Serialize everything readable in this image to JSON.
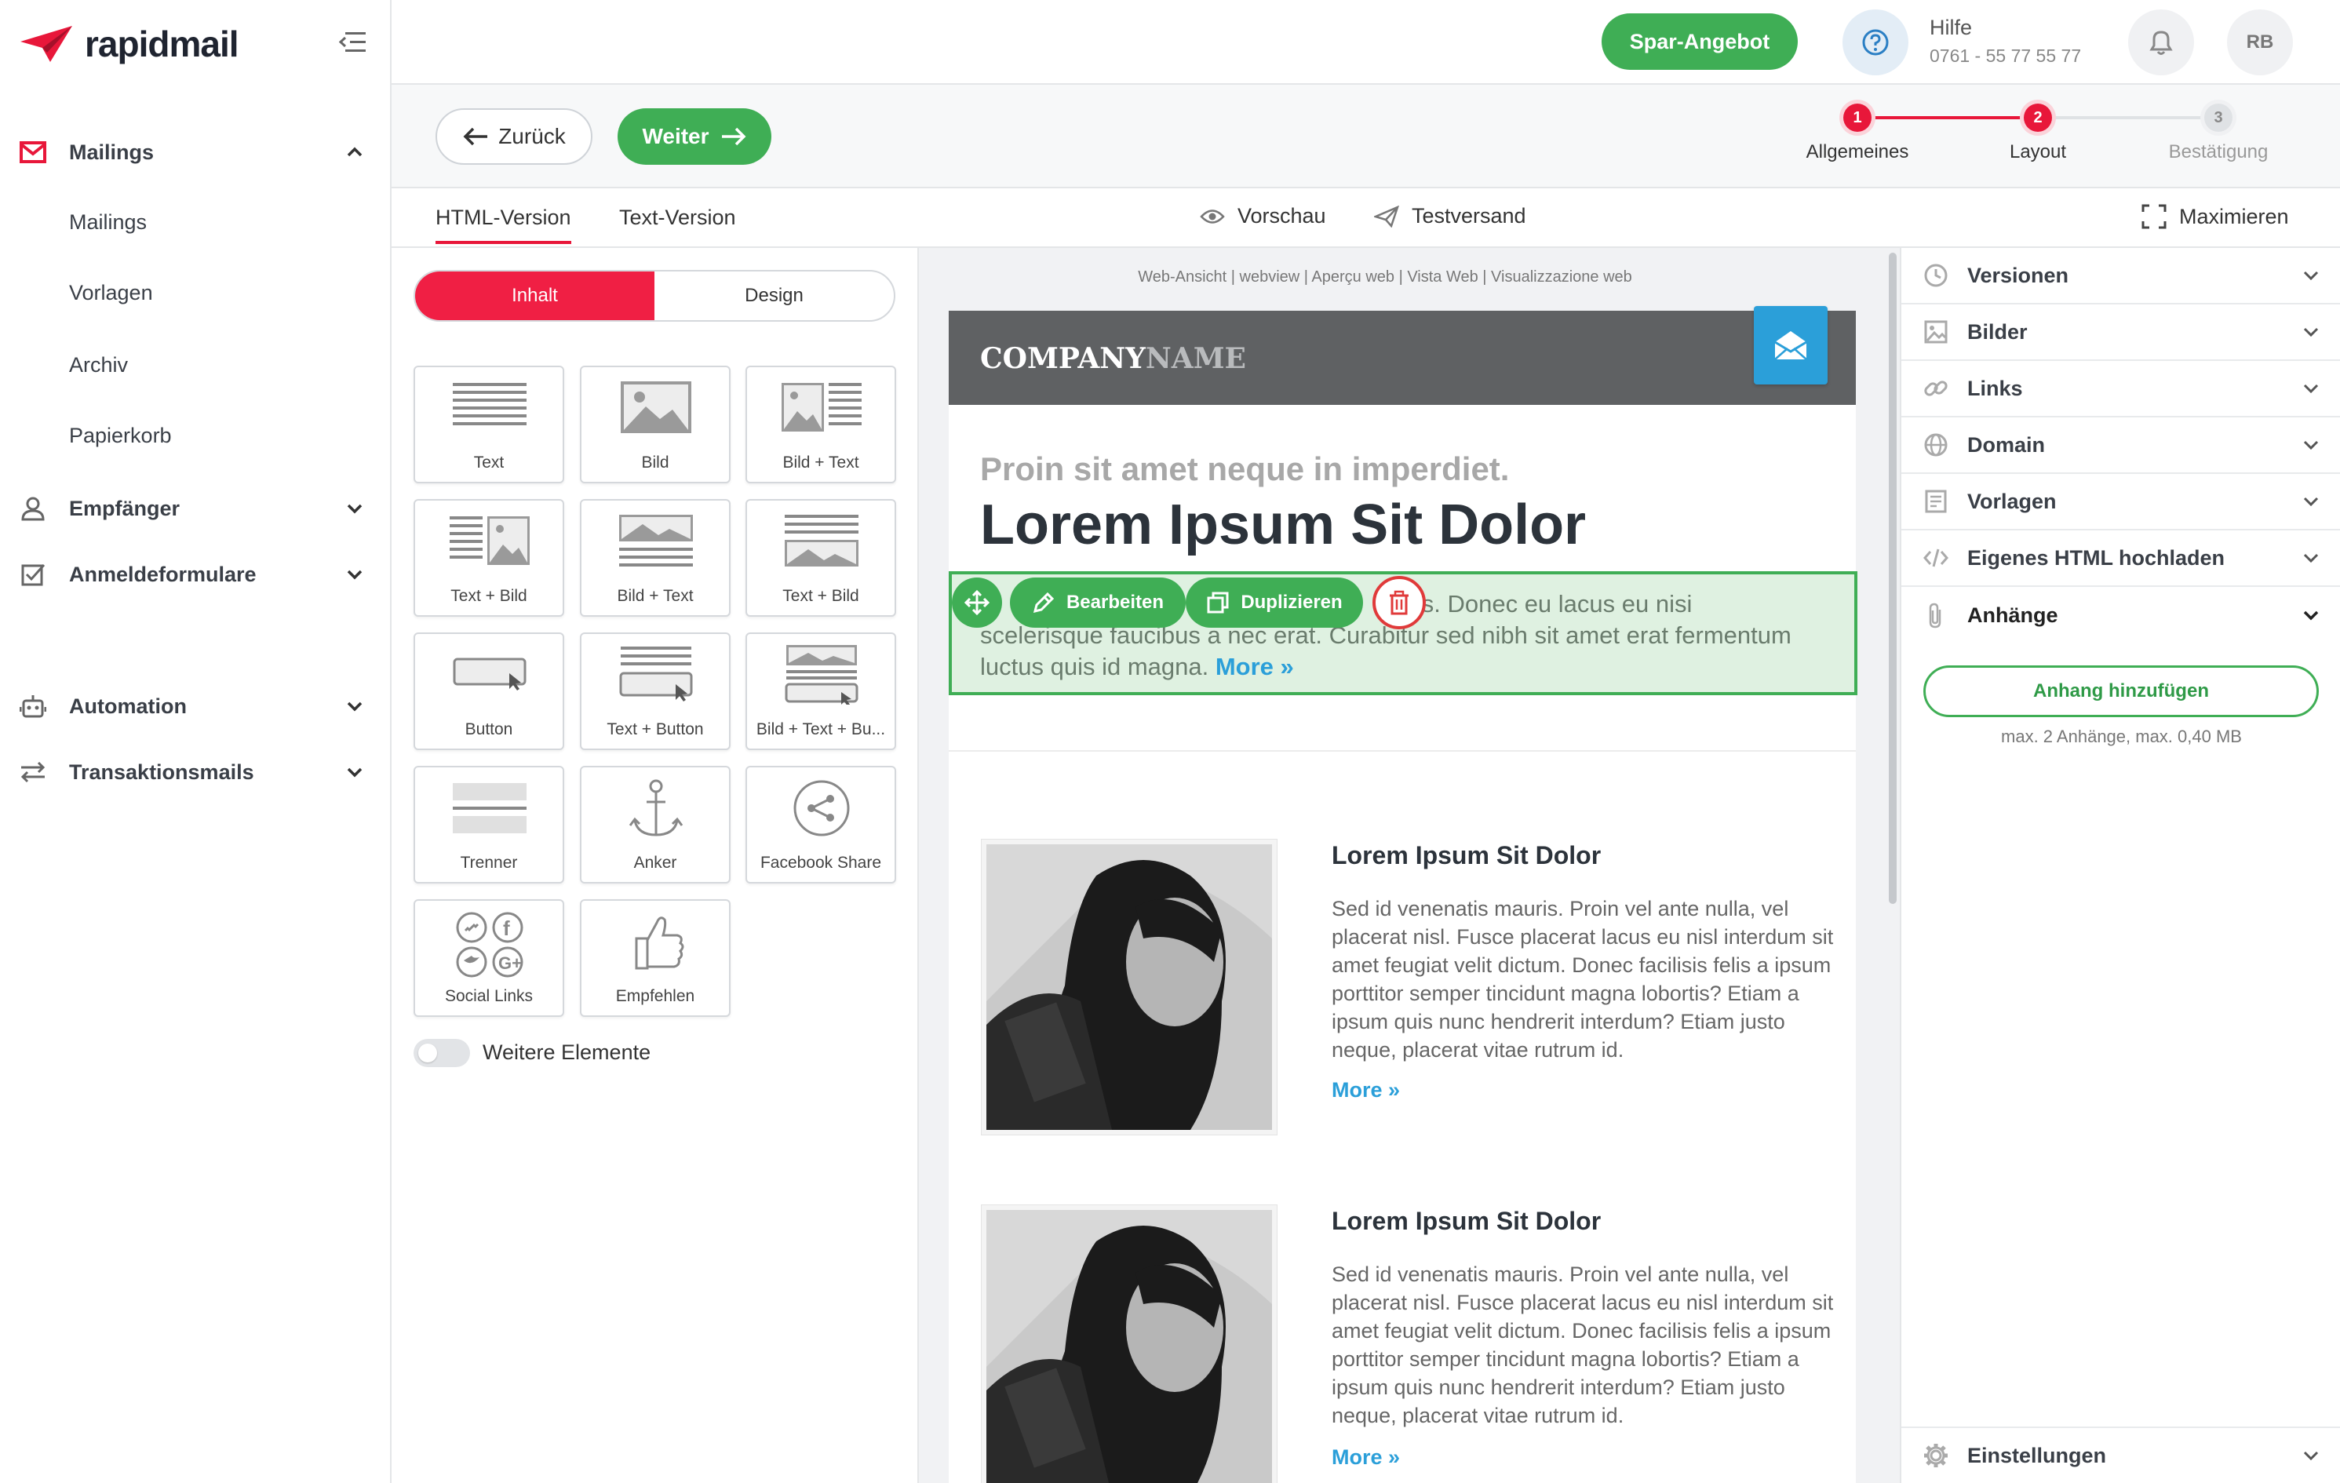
{
  "app": {
    "name": "rapidmail"
  },
  "colors": {
    "brand_red": "#e8173a",
    "green": "#3fae55",
    "blue": "#2b9fd9"
  },
  "sidebar": {
    "mailings": {
      "label": "Mailings",
      "icon": "mail-icon"
    },
    "sub_items": [
      "Mailings",
      "Vorlagen",
      "Archiv",
      "Papierkorb"
    ],
    "empfaenger": {
      "label": "Empfänger",
      "icon": "user-icon"
    },
    "anmeldeformulare": {
      "label": "Anmeldeformulare",
      "icon": "checkbox-icon"
    },
    "automation": {
      "label": "Automation",
      "icon": "robot-icon"
    },
    "transaktionsmails": {
      "label": "Transaktionsmails",
      "icon": "swap-icon"
    }
  },
  "header": {
    "spar_label": "Spar-Angebot",
    "help_title": "Hilfe",
    "help_phone": "0761 - 55 77 55 77",
    "avatar_initials": "RB"
  },
  "toolbar": {
    "back_label": "Zurück",
    "next_label": "Weiter",
    "steps": [
      {
        "num": "1",
        "label": "Allgemeines",
        "state": "done"
      },
      {
        "num": "2",
        "label": "Layout",
        "state": "active"
      },
      {
        "num": "3",
        "label": "Bestätigung",
        "state": "pending"
      }
    ]
  },
  "tabs": {
    "html_version": "HTML-Version",
    "text_version": "Text-Version",
    "preview": "Vorschau",
    "test_send": "Testversand",
    "maximize": "Maximieren"
  },
  "blocks": {
    "segment": {
      "content": "Inhalt",
      "design": "Design"
    },
    "tiles": [
      "Text",
      "Bild",
      "Bild + Text",
      "Text + Bild",
      "Bild + Text",
      "Text + Bild",
      "Button",
      "Text + Button",
      "Bild + Text + Bu...",
      "Trenner",
      "Anker",
      "Facebook Share",
      "Social Links",
      "Empfehlen"
    ],
    "more_elements": "Weitere Elemente"
  },
  "canvas": {
    "webview_links": "Web-Ansicht | webview | Aperçu web | Vista Web | Visualizzazione web",
    "company_a": "COMPANY",
    "company_b": "NAME",
    "subheading": "Proin sit amet neque in imperdiet.",
    "heading": "Lorem Ipsum Sit Dolor",
    "selected_text_a": "ces. Donec eu lacus eu nisi",
    "selected_text_b": "scelerisque faucibus a nec erat. Curabitur sed nibh sit amet erat fermentum luctus quis id magna. ",
    "selected_more": "More »",
    "edit_label": "Bearbeiten",
    "duplicate_label": "Duplizieren",
    "articles": [
      {
        "title": "Lorem Ipsum Sit Dolor",
        "body": "Sed id venenatis mauris. Proin vel ante nulla, vel placerat nisl. Fusce placerat lacus eu nisl interdum sit amet feugiat velit dictum. Donec facilisis felis a ipsum porttitor semper tincidunt magna lobortis? Etiam a ipsum quis nunc hendrerit interdum? Etiam justo neque, placerat vitae rutrum id.",
        "more": "More »"
      },
      {
        "title": "Lorem Ipsum Sit Dolor",
        "body": "Sed id venenatis mauris. Proin vel ante nulla, vel placerat nisl. Fusce placerat lacus eu nisl interdum sit amet feugiat velit dictum. Donec facilisis felis a ipsum porttitor semper tincidunt magna lobortis? Etiam a ipsum quis nunc hendrerit interdum? Etiam justo neque, placerat vitae rutrum id.",
        "more": "More »"
      }
    ]
  },
  "right_panel": {
    "sections": [
      {
        "label": "Versionen",
        "icon": "clock-icon",
        "expanded": false
      },
      {
        "label": "Bilder",
        "icon": "image-icon",
        "expanded": false
      },
      {
        "label": "Links",
        "icon": "link-icon",
        "expanded": false
      },
      {
        "label": "Domain",
        "icon": "globe-icon",
        "expanded": false
      },
      {
        "label": "Vorlagen",
        "icon": "template-icon",
        "expanded": false
      },
      {
        "label": "Eigenes HTML hochladen",
        "icon": "code-icon",
        "expanded": false
      },
      {
        "label": "Anhänge",
        "icon": "paperclip-icon",
        "expanded": true
      }
    ],
    "attach_button": "Anhang hinzufügen",
    "attach_note": "max. 2 Anhänge, max. 0,40 MB",
    "settings": {
      "label": "Einstellungen",
      "icon": "gear-icon"
    }
  }
}
